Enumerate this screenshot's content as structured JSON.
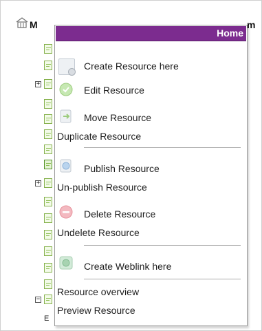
{
  "tree": {
    "title_start": "M",
    "title_end": "m",
    "partial_child": "E"
  },
  "menu": {
    "header": "Home",
    "items": [
      {
        "label": "Create Resource here",
        "icon": "create-resource-icon"
      },
      {
        "label": "Edit Resource",
        "icon": "edit-resource-icon"
      },
      {
        "label": "Move Resource",
        "icon": "move-resource-icon"
      },
      {
        "label": "Duplicate Resource",
        "icon": ""
      },
      {
        "label": "Publish Resource",
        "icon": "publish-resource-icon"
      },
      {
        "label": "Un-publish Resource",
        "icon": ""
      },
      {
        "label": "Delete Resource",
        "icon": "delete-resource-icon"
      },
      {
        "label": "Undelete Resource",
        "icon": ""
      },
      {
        "label": "Create Weblink here",
        "icon": "create-weblink-icon"
      },
      {
        "label": "Resource overview",
        "icon": ""
      },
      {
        "label": "Preview Resource",
        "icon": ""
      }
    ]
  },
  "colors": {
    "header_bg": "#7c2c8f",
    "header_text": "#ffffff",
    "separator": "#a9a9a9",
    "tree_node_border": "#84b04a"
  }
}
